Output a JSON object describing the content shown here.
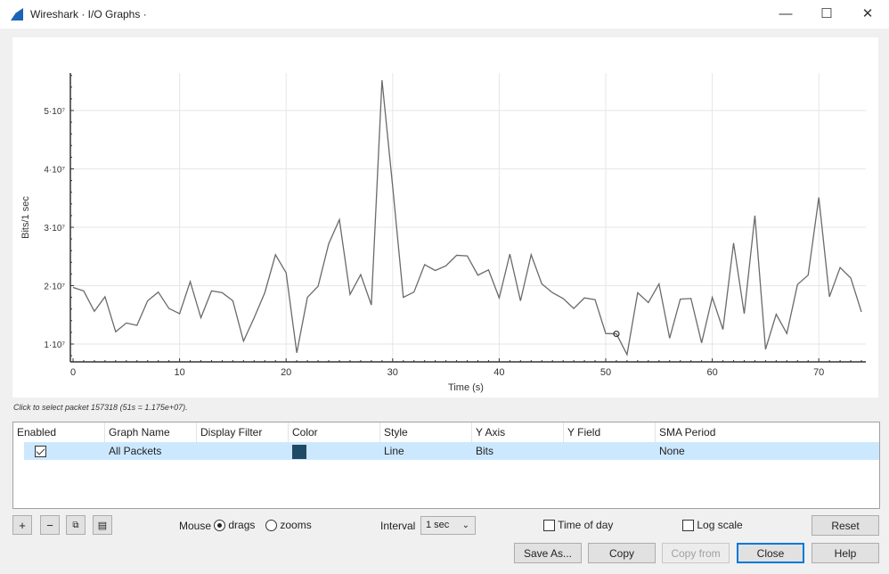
{
  "window": {
    "title": "Wireshark · I/O Graphs ·",
    "minimize": "—",
    "maximize": "☐",
    "close": "✕"
  },
  "status_text": "Click to select packet 157318 (51s = 1.175e+07).",
  "chart_data": {
    "type": "line",
    "xlabel": "Time (s)",
    "ylabel": "Bits/1 sec",
    "xlim": [
      0,
      74.5
    ],
    "ylim": [
      7000000,
      56600000
    ],
    "x_ticks": [
      "0",
      "10",
      "20",
      "30",
      "40",
      "50",
      "60",
      "70"
    ],
    "y_ticks": [
      {
        "value": 10000000,
        "label": "1·10⁷"
      },
      {
        "value": 20000000,
        "label": "2·10⁷"
      },
      {
        "value": 30000000,
        "label": "3·10⁷"
      },
      {
        "value": 40000000,
        "label": "4·10⁷"
      },
      {
        "value": 50000000,
        "label": "5·10⁷"
      }
    ],
    "grid": true,
    "line_color": "#6a6a6a",
    "selected_point": {
      "x": 51,
      "y": 11750000
    },
    "series": [
      {
        "name": "All Packets",
        "x": [
          0,
          1,
          2,
          3,
          4,
          5,
          6,
          7,
          8,
          9,
          10,
          11,
          12,
          13,
          14,
          15,
          16,
          17,
          18,
          19,
          20,
          21,
          22,
          23,
          24,
          25,
          26,
          27,
          28,
          29,
          30,
          31,
          32,
          33,
          34,
          35,
          36,
          37,
          38,
          39,
          40,
          41,
          42,
          43,
          44,
          45,
          46,
          47,
          48,
          49,
          50,
          51,
          52,
          53,
          54,
          55,
          56,
          57,
          58,
          59,
          60,
          61,
          62,
          63,
          64,
          65,
          66,
          67,
          68,
          69,
          70,
          71,
          72,
          73,
          74
        ],
        "y": [
          19700000,
          19100000,
          15600000,
          18100000,
          12100000,
          13600000,
          13200000,
          17400000,
          18900000,
          16100000,
          15200000,
          20700000,
          14500000,
          19100000,
          18800000,
          17400000,
          10500000,
          14500000,
          18800000,
          25300000,
          22200000,
          8500000,
          18000000,
          19900000,
          27200000,
          31300000,
          18500000,
          21900000,
          16700000,
          55200000,
          37000000,
          18000000,
          18900000,
          23600000,
          22600000,
          23400000,
          25200000,
          25100000,
          21800000,
          22700000,
          17900000,
          25400000,
          17400000,
          25300000,
          20300000,
          18800000,
          17800000,
          16100000,
          17900000,
          17600000,
          11800000,
          11750000,
          8200000,
          18800000,
          17100000,
          20300000,
          11000000,
          17700000,
          17800000,
          10200000,
          18000000,
          12500000,
          27300000,
          15200000,
          32000000,
          9100000,
          15100000,
          11800000,
          20200000,
          21800000,
          35100000,
          18100000,
          23100000,
          21300000,
          15500000
        ]
      }
    ]
  },
  "table": {
    "headers": [
      "Enabled",
      "Graph Name",
      "Display Filter",
      "Color",
      "Style",
      "Y Axis",
      "Y Field",
      "SMA Period"
    ],
    "rows": [
      {
        "enabled": true,
        "name": "All Packets",
        "filter": "",
        "color": "#1f4a66",
        "style": "Line",
        "y_axis": "Bits",
        "y_field": "",
        "sma": "None"
      }
    ]
  },
  "controls": {
    "add": "+",
    "remove": "−",
    "mouse_label": "Mouse",
    "drags": "drags",
    "zooms": "zooms",
    "mouse_mode": "drags",
    "interval_label": "Interval",
    "interval_value": "1 sec",
    "time_of_day": "Time of day",
    "time_of_day_checked": false,
    "log_scale": "Log scale",
    "log_scale_checked": false,
    "reset": "Reset",
    "save_as": "Save As...",
    "copy": "Copy",
    "copy_from": "Copy from",
    "close": "Close",
    "help": "Help"
  }
}
